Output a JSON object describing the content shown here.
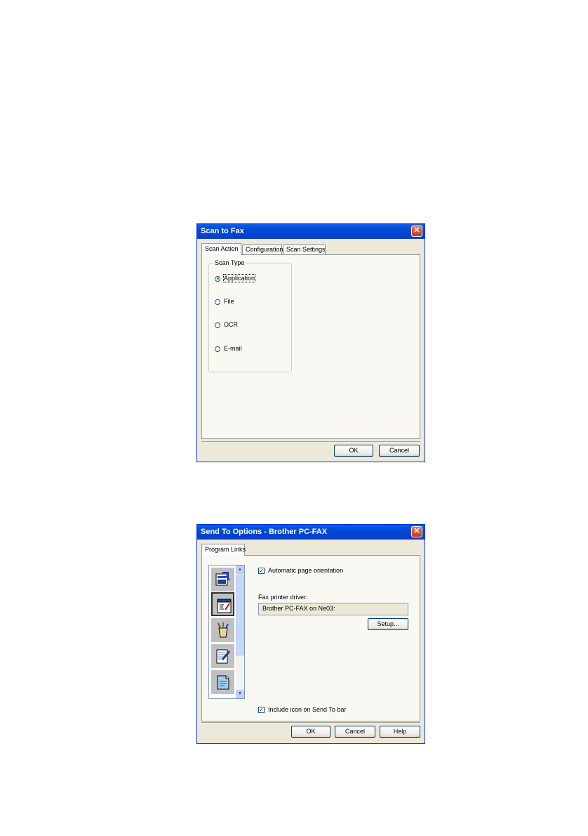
{
  "dialog1": {
    "title": "Scan to Fax",
    "close_glyph": "✕",
    "tabs": [
      "Scan Action",
      "Configuration",
      "Scan Settings"
    ],
    "group_label": "Scan Type",
    "options": [
      "Application",
      "File",
      "OCR",
      "E-mail"
    ],
    "selected_option": "Application",
    "buttons": {
      "ok": "OK",
      "cancel": "Cancel"
    }
  },
  "dialog2": {
    "title": "Send To Options - Brother PC-FAX",
    "close_glyph": "✕",
    "tabs": [
      "Program Links"
    ],
    "icons": [
      "application-link-icon",
      "fax-link-icon",
      "paint-link-icon",
      "notepad-link-icon",
      "document-link-icon"
    ],
    "auto_orientation": {
      "label": "Automatic page orientation",
      "checked": true
    },
    "fax_driver_label": "Fax printer driver:",
    "fax_driver_value": "Brother PC-FAX on Ne03:",
    "setup_button": "Setup...",
    "include_icon": {
      "label": "Include icon on Send To bar",
      "checked": true
    },
    "check_glyph": "✓",
    "scroll_up": "▲",
    "scroll_down": "▼",
    "buttons": {
      "ok": "OK",
      "cancel": "Cancel",
      "help": "Help"
    }
  },
  "colors": {
    "title_blue": "#0048d8",
    "face": "#ece9d8",
    "close_red": "#c6381f"
  }
}
